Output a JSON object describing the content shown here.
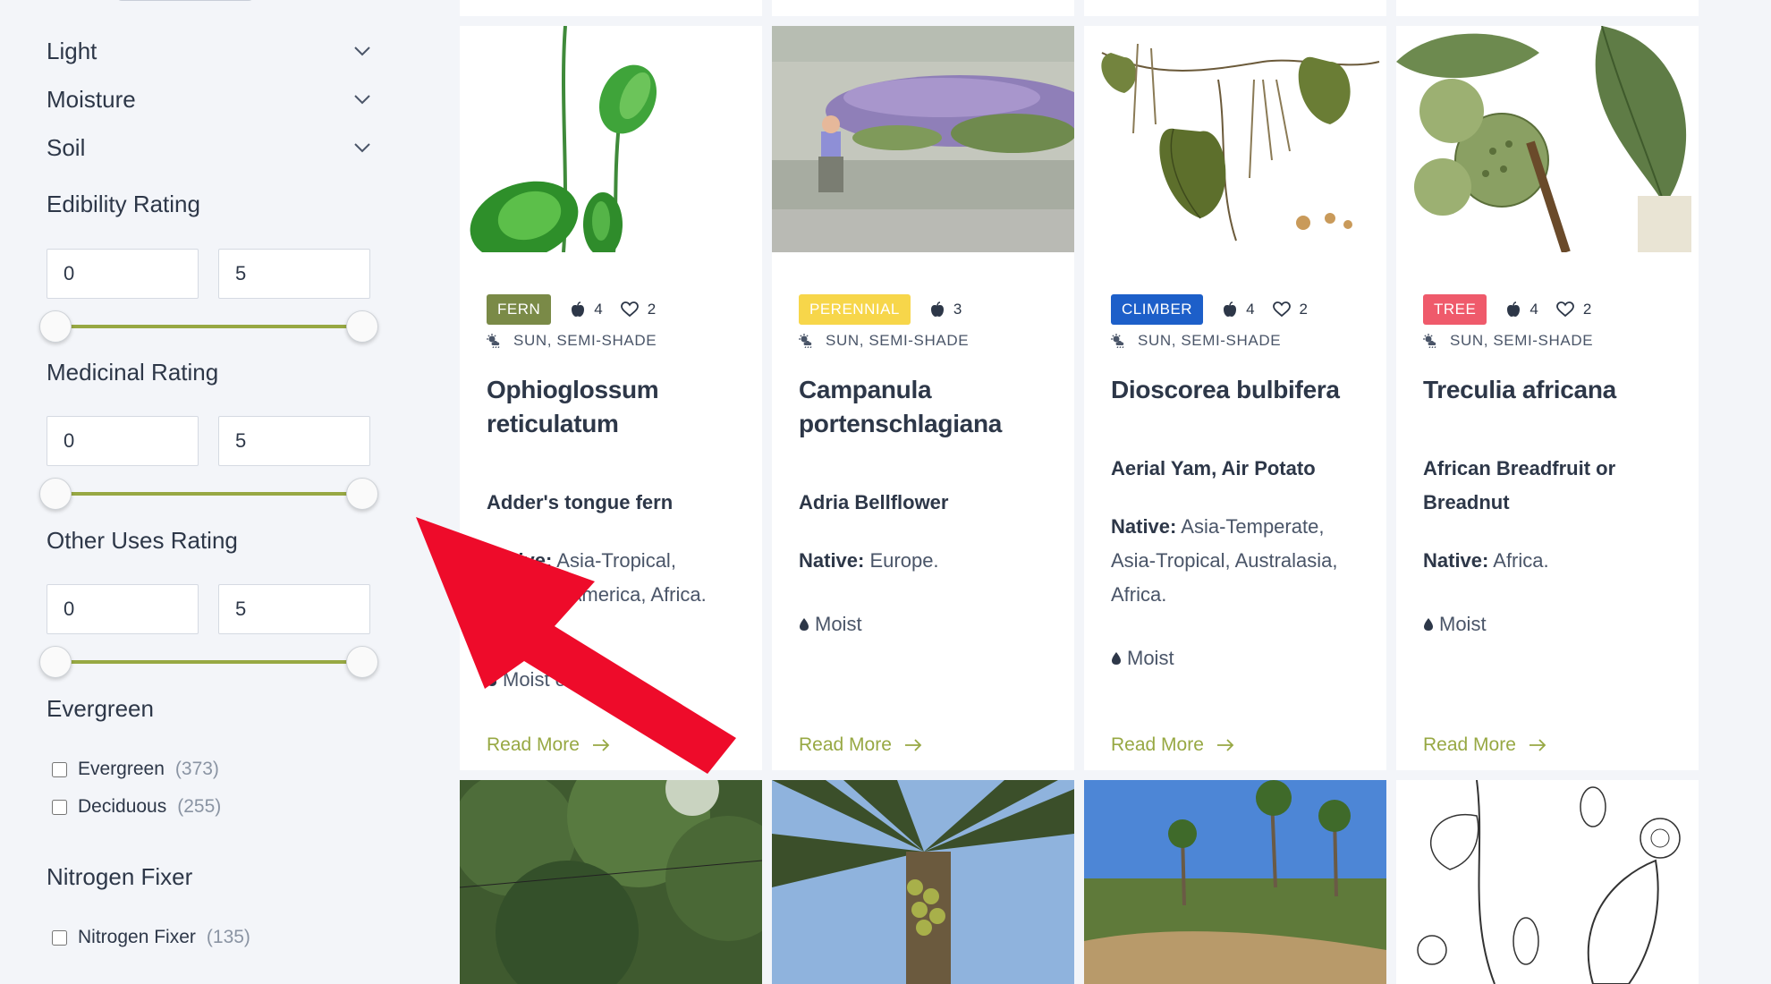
{
  "filters": {
    "accordions": [
      {
        "label": "Light"
      },
      {
        "label": "Moisture"
      },
      {
        "label": "Soil"
      }
    ],
    "edibility": {
      "title": "Edibility Rating",
      "min": "0",
      "max": "5"
    },
    "medicinal": {
      "title": "Medicinal Rating",
      "min": "0",
      "max": "5"
    },
    "other_uses": {
      "title": "Other Uses Rating",
      "min": "0",
      "max": "5"
    },
    "evergreen": {
      "title": "Evergreen",
      "options": [
        {
          "label": "Evergreen",
          "count": "(373)"
        },
        {
          "label": "Deciduous",
          "count": "(255)"
        }
      ]
    },
    "nitrogen": {
      "title": "Nitrogen Fixer",
      "options": [
        {
          "label": "Nitrogen Fixer",
          "count": "(135)"
        }
      ]
    }
  },
  "cards": [
    {
      "badge": "FERN",
      "badge_color": "#7a8a47",
      "edible": "4",
      "favorites": "2",
      "sun": "SUN, SEMI-SHADE",
      "name": "Ophioglossum reticulatum",
      "common": "Adder's tongue fern",
      "native_label": "Native:",
      "native": "Asia-Tropical, America, America, Africa.",
      "moisture": "Moist or",
      "read_more": "Read More"
    },
    {
      "badge": "PERENNIAL",
      "badge_color": "#f7d64a",
      "edible": "3",
      "sun": "SUN, SEMI-SHADE",
      "name": "Campanula portenschlagiana",
      "common": "Adria Bellflower",
      "native_label": "Native:",
      "native": "Europe.",
      "moisture": "Moist",
      "read_more": "Read More"
    },
    {
      "badge": "CLIMBER",
      "badge_color": "#1d5fc9",
      "edible": "4",
      "favorites": "2",
      "sun": "SUN, SEMI-SHADE",
      "name": "Dioscorea bulbifera",
      "common": "Aerial Yam, Air Potato",
      "native_label": "Native:",
      "native": "Asia-Temperate, Asia-Tropical, Australasia, Africa.",
      "moisture": "Moist",
      "read_more": "Read More"
    },
    {
      "badge": "TREE",
      "badge_color": "#ef5a6b",
      "edible": "4",
      "favorites": "2",
      "sun": "SUN, SEMI-SHADE",
      "name": "Treculia africana",
      "common": "African Breadfruit or Breadnut",
      "native_label": "Native:",
      "native": "Africa.",
      "moisture": "Moist",
      "read_more": "Read More"
    }
  ]
}
